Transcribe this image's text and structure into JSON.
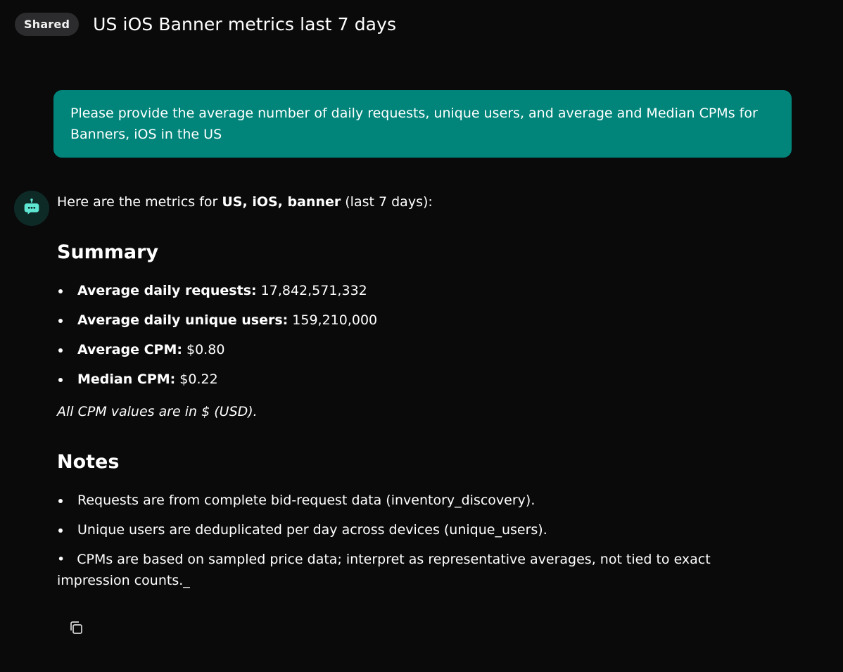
{
  "header": {
    "badge": "Shared",
    "title": "US iOS Banner metrics last 7 days"
  },
  "user_message": "Please provide the average number of daily requests, unique users, and average and Median CPMs for Banners, iOS in the US",
  "assistant": {
    "avatar_icon": "robot-icon",
    "intro": {
      "prefix": "Here are the metrics for ",
      "bold": "US, iOS, banner",
      "suffix": " (last 7 days):"
    },
    "summary": {
      "heading": "Summary",
      "items": [
        {
          "label": "Average daily requests:",
          "value": " 17,842,571,332"
        },
        {
          "label": "Average daily unique users:",
          "value": " 159,210,000"
        },
        {
          "label": "Average CPM:",
          "value": " $0.80"
        },
        {
          "label": "Median CPM:",
          "value": " $0.22"
        }
      ],
      "footnote": "All CPM values are in $ (USD)."
    },
    "notes": {
      "heading": "Notes",
      "items": [
        "Requests are from complete bid-request data (inventory_discovery).",
        "Unique users are deduplicated per day across devices (unique_users)."
      ],
      "paragraph": "CPMs are based on sampled price data; interpret as representative averages, not tied to exact impression counts._"
    },
    "copy_icon": "copy-icon"
  },
  "colors": {
    "background": "#0a0a0a",
    "user_bubble": "#01857a",
    "badge_bg": "#2c2c2e",
    "avatar_accent": "#5ee6d2"
  }
}
